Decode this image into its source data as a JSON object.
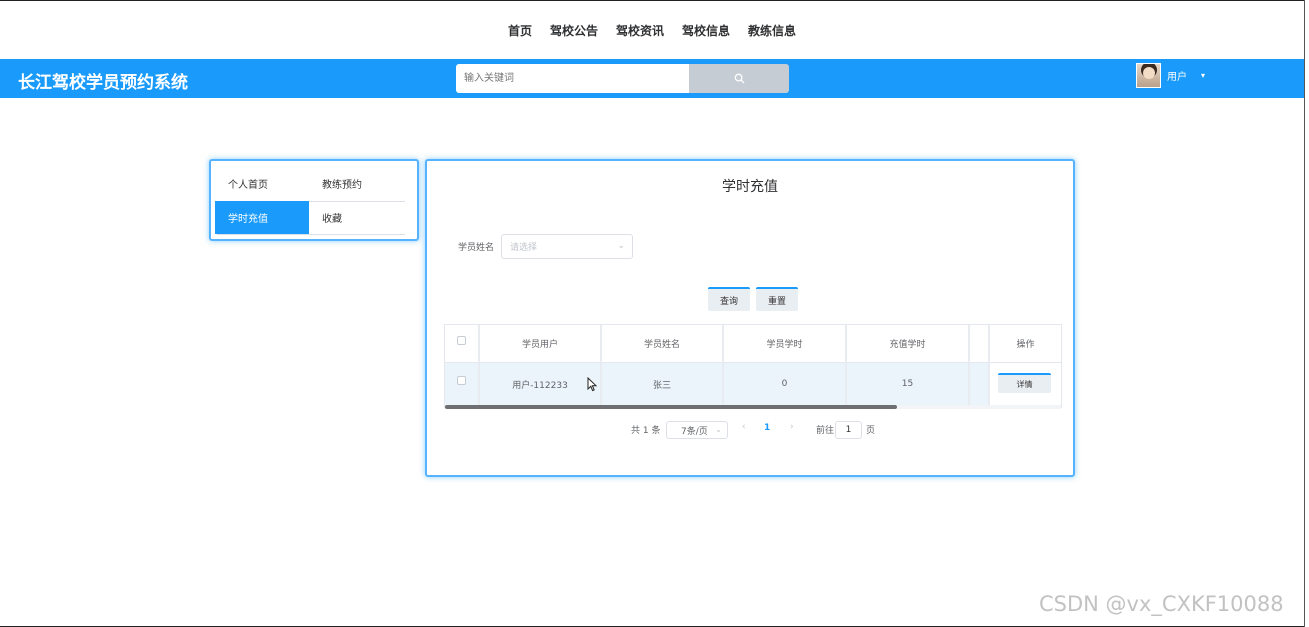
{
  "nav": [
    "首页",
    "驾校公告",
    "驾校资讯",
    "驾校信息",
    "教练信息"
  ],
  "brand": "长江驾校学员预约系统",
  "search": {
    "placeholder": "输入关键词"
  },
  "user": {
    "name": "用户"
  },
  "side_menu": [
    {
      "label": "个人首页",
      "active": false
    },
    {
      "label": "教练预约",
      "active": false
    },
    {
      "label": "学时充值",
      "active": true
    },
    {
      "label": "收藏",
      "active": false
    }
  ],
  "page": {
    "title": "学时充值",
    "filter_label": "学员姓名",
    "filter_placeholder": "请选择",
    "query_button": "查询",
    "reset_button": "重置"
  },
  "table": {
    "columns": [
      "学员用户",
      "学员姓名",
      "学员学时",
      "充值学时",
      "操作"
    ],
    "rows": [
      {
        "user": "用户-112233",
        "name": "张三",
        "hours": "0",
        "recharge": "15",
        "action": "详情"
      }
    ]
  },
  "pagination": {
    "total": "共 1 条",
    "page_size": "7条/页",
    "current": "1",
    "goto_label": "前往",
    "goto_value": "1",
    "page_suffix": "页"
  },
  "watermark": "CSDN @vx_CXKF10088",
  "colors": {
    "accent": "#1a9bfc",
    "panel_border": "#56b3ff"
  }
}
